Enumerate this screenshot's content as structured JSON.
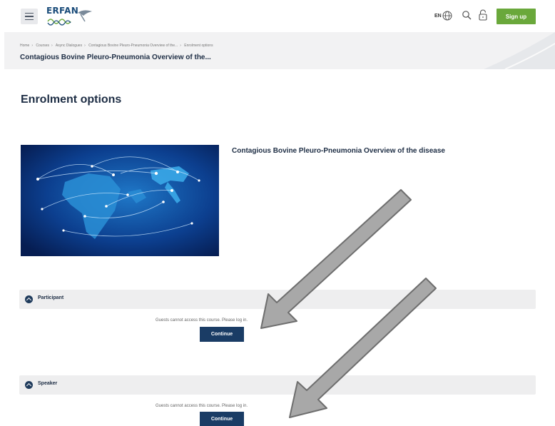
{
  "header": {
    "logo_text": "ERFAN",
    "language": "EN",
    "signup_label": "Sign up"
  },
  "breadcrumb": {
    "items": [
      "Home",
      "Courses",
      "Async Dialogues",
      "Contagious Bovine Pleuro-Pneumonia Overview of the...",
      "Enrolment options"
    ]
  },
  "course": {
    "short_title": "Contagious Bovine Pleuro-Pneumonia Overview of the...",
    "full_title": "Contagious Bovine Pleuro-Pneumonia Overview of the disease"
  },
  "page": {
    "heading": "Enrolment options"
  },
  "sections": [
    {
      "label": "Participant",
      "message": "Guests cannot access this course. Please log in.",
      "button_label": "Continue"
    },
    {
      "label": "Speaker",
      "message": "Guests cannot access this course. Please log in.",
      "button_label": "Continue"
    }
  ],
  "colors": {
    "accent_green": "#6aa83b",
    "navy": "#1a3c65",
    "text": "#1d2d44"
  },
  "icons": [
    "menu-icon",
    "globe-icon",
    "search-icon",
    "lock-icon",
    "chevron-up-icon"
  ]
}
